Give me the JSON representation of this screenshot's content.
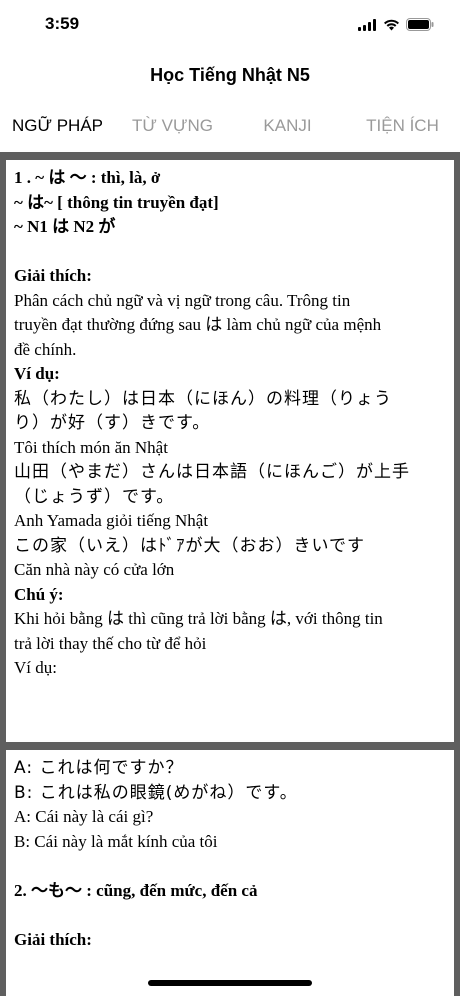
{
  "status": {
    "time": "3:59"
  },
  "header": {
    "title": "Học Tiếng Nhật N5"
  },
  "tabs": [
    {
      "label": "NGỮ PHÁP"
    },
    {
      "label": "TỪ VỰNG"
    },
    {
      "label": "KANJI"
    },
    {
      "label": "TIỆN ÍCH"
    }
  ],
  "card1": {
    "lines": [
      "1 . ~ は ～  :  thì, là, ở",
      "~ は~ [ thông tin truyền đạt]",
      "~ N1 は N2 が",
      "Giải thích:",
      "Phân cách chủ ngữ và vị ngữ trong câu. Trông tin",
      "truyền đạt thường đứng sau は làm chủ ngữ của mệnh",
      "đề chính.",
      "Ví dụ:",
      "私（わたし）は日本（にほん）の料理（りょう",
      "り）が好（す）きです。",
      "Tôi thích món ăn Nhật",
      "山田（やまだ）さんは日本語（にほんご）が上手",
      "（じょうず）です。",
      "Anh Yamada giỏi tiếng Nhật",
      "この家（いえ）はﾄﾞｱが大（おお）きいです",
      "Căn nhà này có cửa lớn",
      "Chú ý:",
      "Khi hỏi bằng は thì cũng trả lời bằng は, với thông tin",
      "trả lời thay thế cho từ để hỏi",
      "Ví dụ:"
    ]
  },
  "card2": {
    "lines": [
      "A: これは何ですか？",
      "B: これは私の眼鏡(めがね）です。",
      "A: Cái này là cái gì?",
      "B: Cái này là mắt kính của tôi",
      "2. ～も～ : cũng, đến mức, đến cả",
      "Giải thích:"
    ]
  }
}
